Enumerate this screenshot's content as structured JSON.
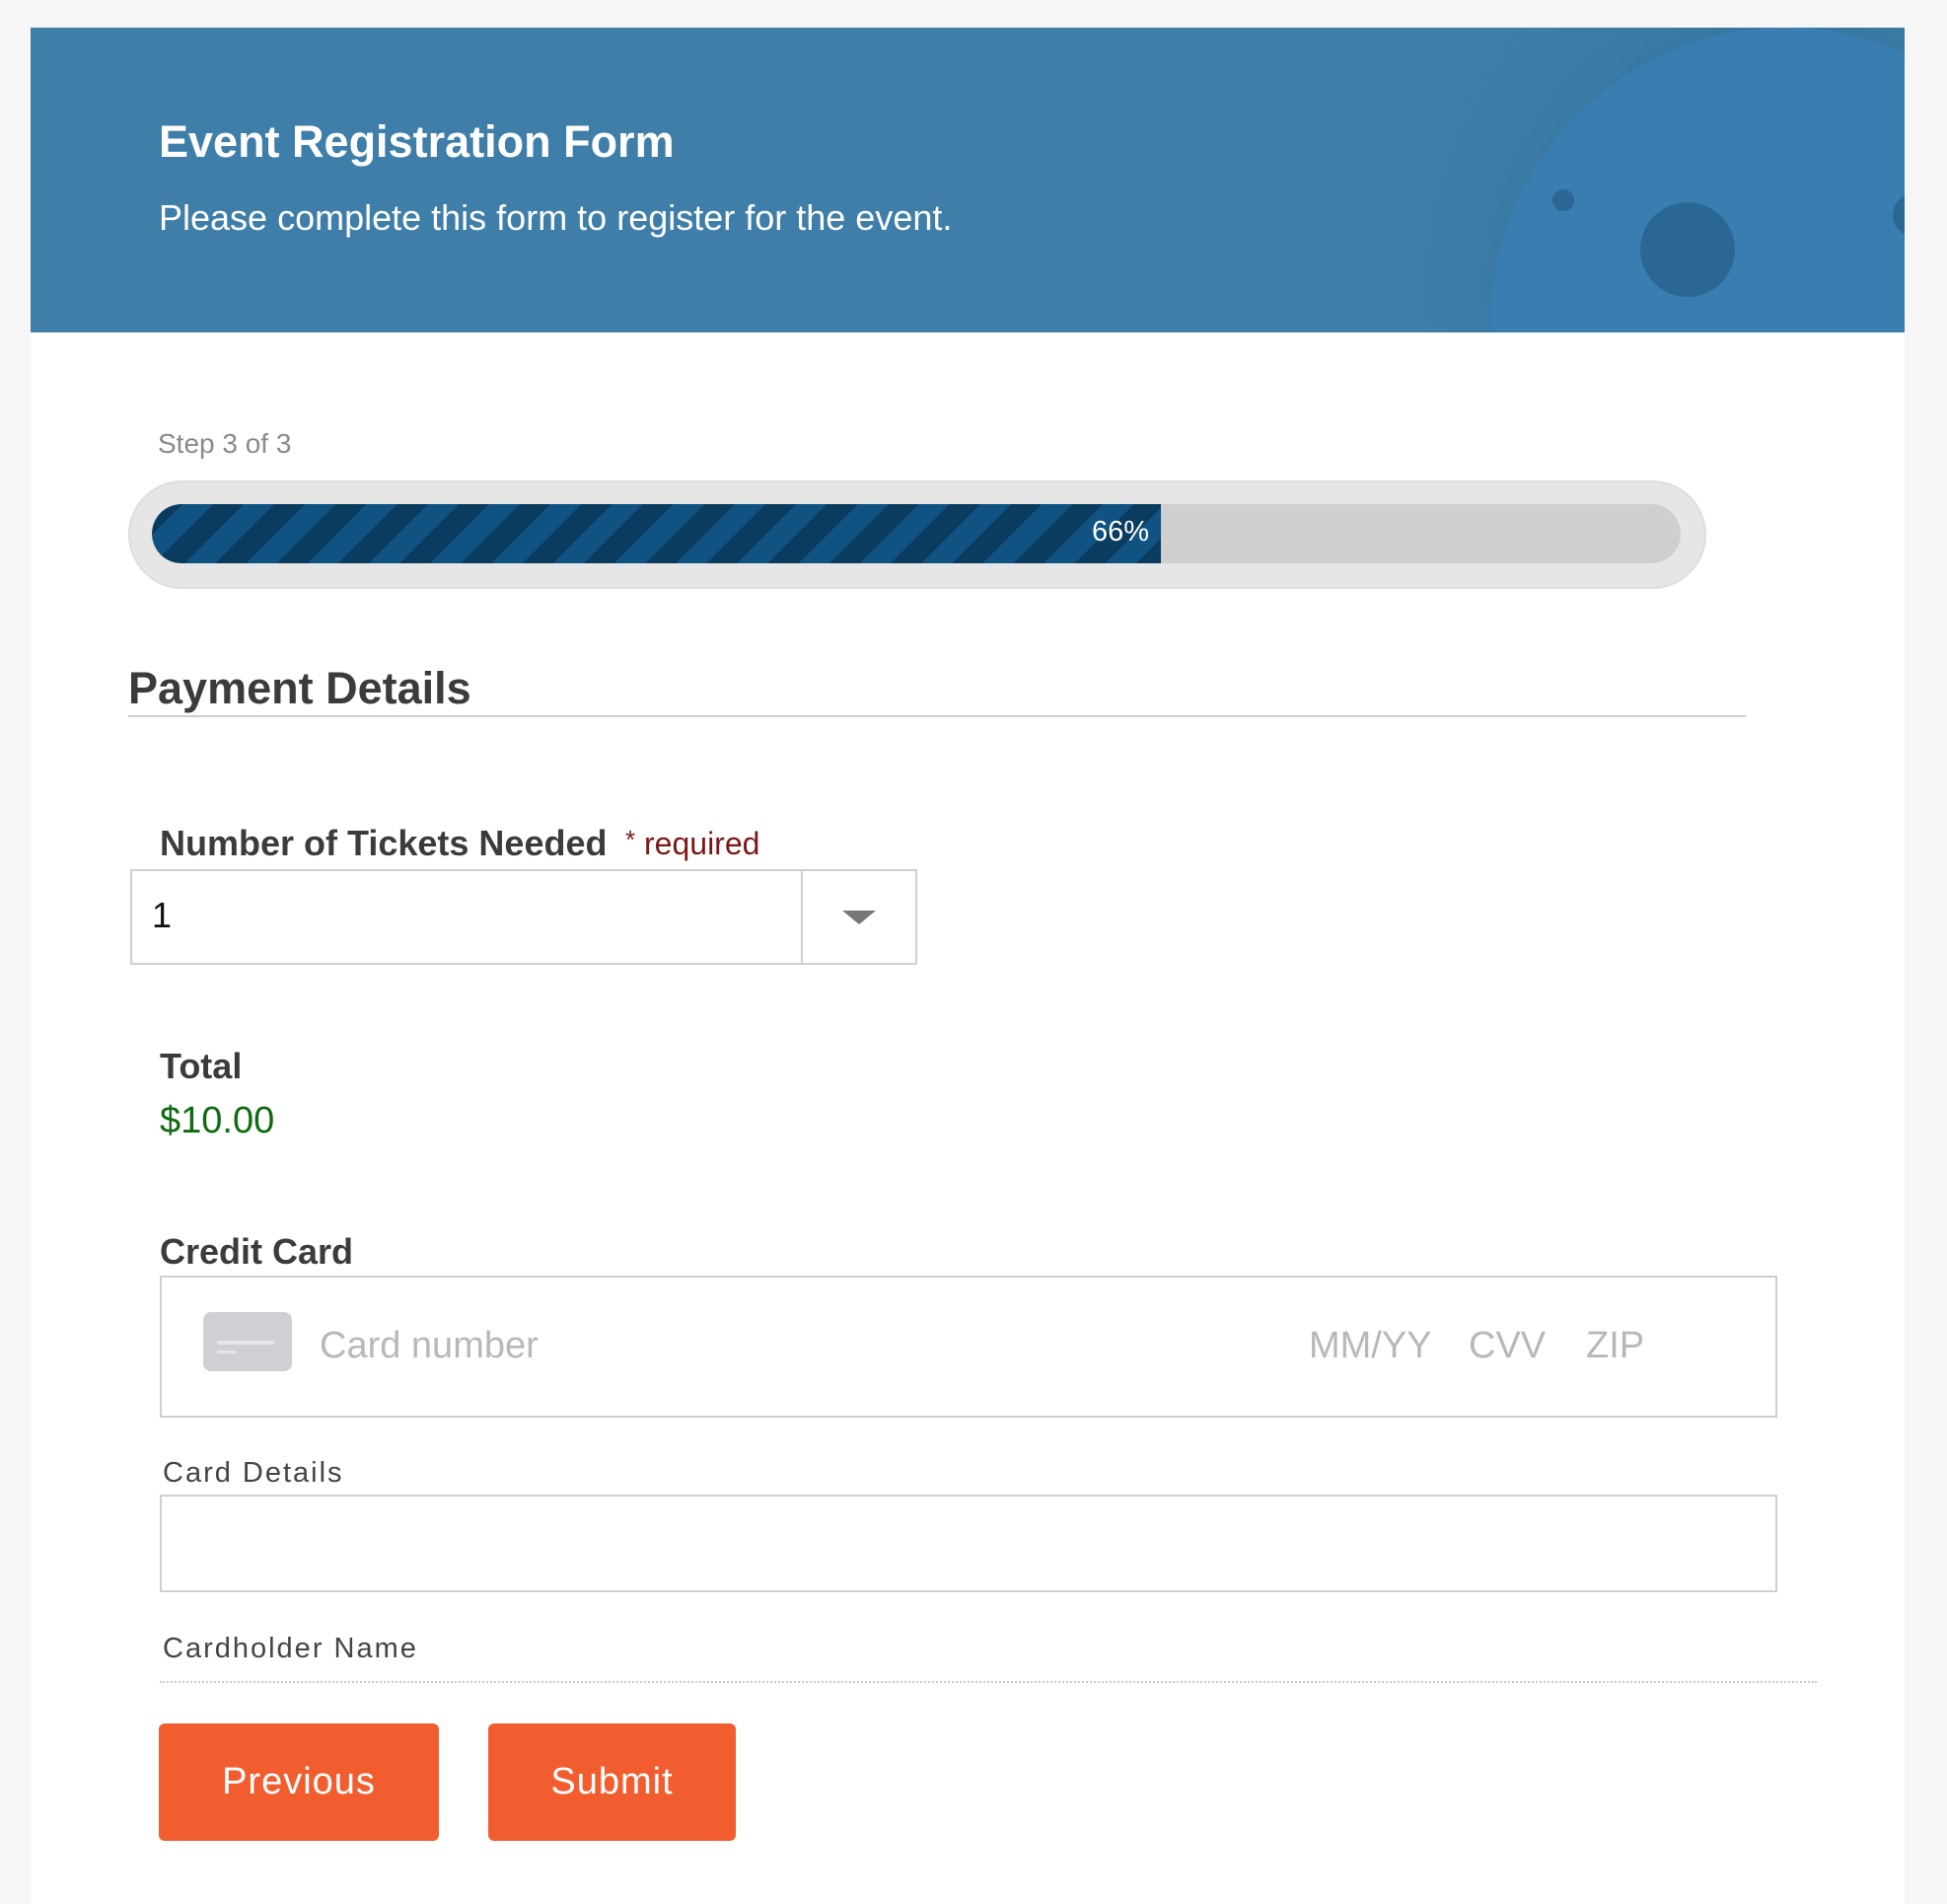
{
  "header": {
    "title": "Event Registration Form",
    "subtitle": "Please complete this form to register for the event.",
    "background_color": "#3e7ea8"
  },
  "progress": {
    "step_label": "Step 3 of 3",
    "percent": 66,
    "percent_label": "66%",
    "fill_color": "#0e4a73"
  },
  "section": {
    "title": "Payment Details"
  },
  "tickets": {
    "label": "Number of Tickets Needed",
    "required_marker": "*",
    "required_text": "required",
    "selected_value": "1",
    "dropdown_icon": "chevron-down-icon"
  },
  "total": {
    "label": "Total",
    "value": "$10.00"
  },
  "credit_card": {
    "label": "Credit Card",
    "card_icon": "credit-card-icon",
    "card_number_placeholder": "Card number",
    "expiry_placeholder": "MM/YY",
    "cvv_placeholder": "CVV",
    "zip_placeholder": "ZIP",
    "details_sublabel": "Card Details",
    "cardholder_value": "",
    "cardholder_sublabel": "Cardholder Name"
  },
  "buttons": {
    "previous_label": "Previous",
    "submit_label": "Submit",
    "color": "#f15d2e"
  }
}
